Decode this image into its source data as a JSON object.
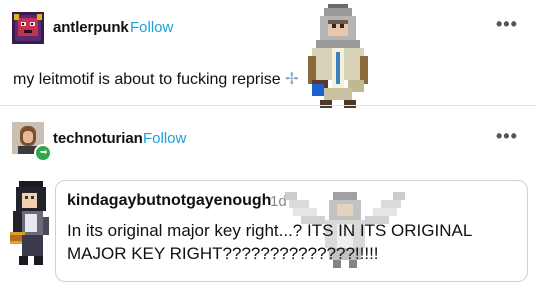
{
  "post1": {
    "username": "antlerpunk",
    "follow_label": "Follow",
    "menu_label": "•••",
    "text": "my leitmotif is about to fucking reprise",
    "emoji": "✢"
  },
  "post2": {
    "username": "technoturian",
    "follow_label": "Follow",
    "menu_label": "•••"
  },
  "reblog": {
    "username": "kindagaybutnotgayenough",
    "timestamp": "1d",
    "text_line1": "In its original major key right...? ITS IN ITS ORIGINAL",
    "text_line2": "MAJOR KEY RIGHT??????????????!!!!!"
  },
  "colors": {
    "follow": "#1ea1d9",
    "divider": "#e4e4e4",
    "badge_green": "#2ea84a"
  }
}
